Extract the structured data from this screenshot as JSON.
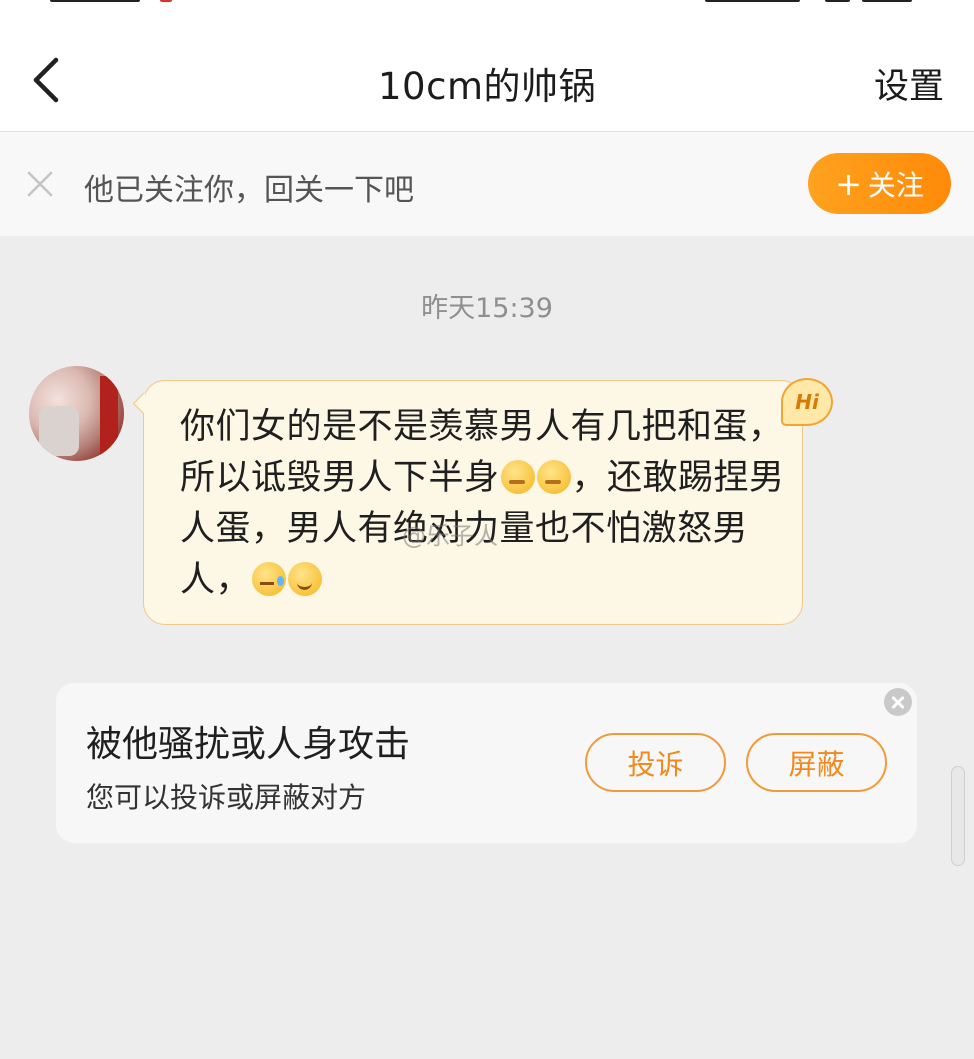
{
  "header": {
    "title": "10cm的帅锅",
    "settings_label": "设置",
    "back_icon": "chevron-left-icon"
  },
  "follow_banner": {
    "text": "他已关注你，回关一下吧",
    "button_plus": "+",
    "button_label": "关注",
    "dismiss_icon": "close-icon",
    "accent": "#ff8a08"
  },
  "chat": {
    "timestamp": "昨天15:39",
    "message": {
      "part1": "你们女的是不是羡慕男人有几把和蛋，所以诋毁男人下半身",
      "part2": "，还敢踢捏男人蛋，男人有绝对力量也不怕激怒男人，",
      "emoji_after_part1": [
        "thinking-emoji",
        "thinking-emoji"
      ],
      "emoji_after_part2": [
        "sweat-emoji",
        "smile-emoji"
      ],
      "badge": "Hi",
      "watermark": "@乐子人"
    }
  },
  "report_card": {
    "title": "被他骚扰或人身攻击",
    "subtitle": "您可以投诉或屏蔽对方",
    "complain_label": "投诉",
    "block_label": "屏蔽",
    "close_icon": "close-icon",
    "accent": "#f08a1c"
  }
}
